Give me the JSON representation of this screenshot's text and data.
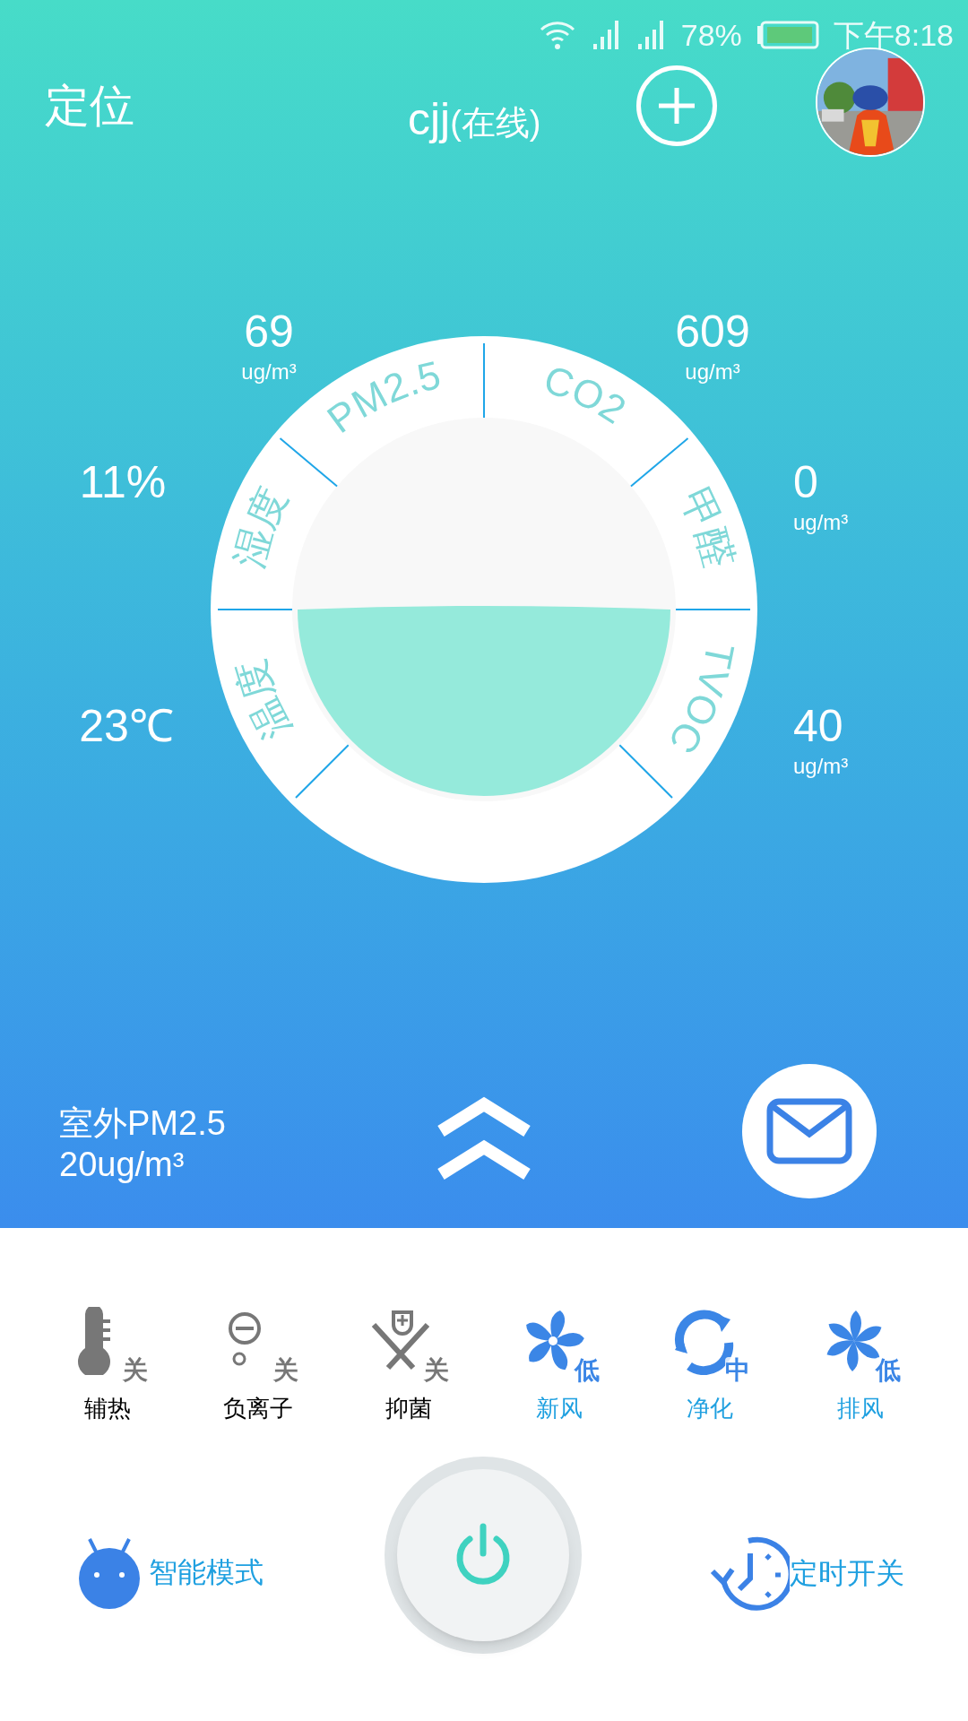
{
  "status_bar": {
    "battery": "78%",
    "time": "下午8:18"
  },
  "header": {
    "left": "定位",
    "device": "cjj",
    "device_status": "(在线)"
  },
  "sensors": [
    {
      "label": "PM2.5",
      "value": "69",
      "unit": "ug/m³"
    },
    {
      "label": "CO2",
      "value": "609",
      "unit": "ug/m³"
    },
    {
      "label": "湿度",
      "value": "11%"
    },
    {
      "label": "甲醛",
      "value": "0",
      "unit": "ug/m³"
    },
    {
      "label": "温度",
      "value": "23℃"
    },
    {
      "label": "TVOC",
      "value": "40",
      "unit": "ug/m³"
    }
  ],
  "outdoor": {
    "label": "室外PM2.5",
    "value": "20ug/m³"
  },
  "functions": [
    {
      "kind": "heat",
      "label": "辅热",
      "badge": "关",
      "on": false
    },
    {
      "kind": "ion",
      "label": "负离子",
      "badge": "关",
      "on": false
    },
    {
      "kind": "germ",
      "label": "抑菌",
      "badge": "关",
      "on": false
    },
    {
      "kind": "fan",
      "label": "新风",
      "badge": "低",
      "on": true
    },
    {
      "kind": "purify",
      "label": "净化",
      "badge": "中",
      "on": true
    },
    {
      "kind": "exhaust",
      "label": "排风",
      "badge": "低",
      "on": true
    }
  ],
  "bottom": {
    "smart_mode": "智能模式",
    "timer": "定时开关"
  }
}
